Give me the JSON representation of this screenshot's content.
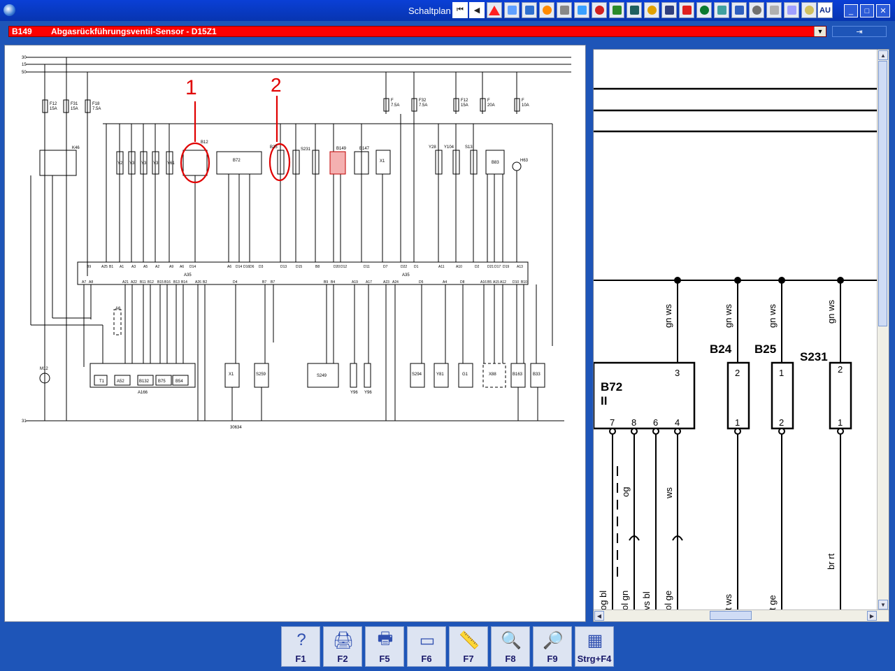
{
  "window": {
    "title": "Schaltplan"
  },
  "toolbar": {
    "nav_first": "⏮",
    "nav_back": "◀",
    "icons": [
      "warning-icon",
      "component-icon",
      "fuse-icon",
      "connector-icon",
      "gauge-icon",
      "wiring-icon",
      "relay-icon",
      "ground-icon",
      "case-icon",
      "earth-icon",
      "tool-icon",
      "signal-icon",
      "tool2-icon",
      "hand-icon",
      "car-icon",
      "check-icon",
      "alarm-icon",
      "chart-icon",
      "list-icon"
    ],
    "language": "AU",
    "min_label": "_",
    "max_label": "□",
    "close_label": "✕"
  },
  "selection": {
    "code": "B149",
    "title": "Abgasrückführungsventil-Sensor - D15Z1",
    "dropdown_arrow": "▼",
    "split_label": "⇥"
  },
  "diagram": {
    "rails": [
      "30",
      "15",
      "50"
    ],
    "ground_rail": "31",
    "fuses": [
      {
        "name": "F12",
        "rating": "15A"
      },
      {
        "name": "F31",
        "rating": "15A"
      },
      {
        "name": "F18",
        "rating": "7.5A"
      },
      {
        "name": "F",
        "rating": "7.5A"
      },
      {
        "name": "F32",
        "rating": "7.5A"
      },
      {
        "name": "F12",
        "rating": "15A"
      },
      {
        "name": "F",
        "rating": "20A"
      },
      {
        "name": "F",
        "rating": "10A"
      }
    ],
    "components_top": [
      "K46",
      "Y2",
      "Y3",
      "Y3",
      "Y3",
      "Y61",
      "B12",
      "B72",
      "B25",
      "S231",
      "B149",
      "B147",
      "X1",
      "Y28",
      "Y104",
      "S13",
      "B83",
      "H63"
    ],
    "roman": [
      "I",
      "II",
      "III",
      "IV",
      "II",
      "I"
    ],
    "ecu": "A35",
    "ecu_label_2": "A35",
    "ecu_pins_top": [
      "B9",
      "A25",
      "B1",
      "A1",
      "A3",
      "A5",
      "A2",
      "A9",
      "A6",
      "D14",
      "A6",
      "D14",
      "D16",
      "D6",
      "D3",
      "D13",
      "D15",
      "B8",
      "D20",
      "D12",
      "D11",
      "D7",
      "D22",
      "D1",
      "A11",
      "A10",
      "D2",
      "D21",
      "D17",
      "D19",
      "A13"
    ],
    "ecu_pins_bottom": [
      "A7",
      "A8",
      "A21",
      "A22",
      "B11",
      "B12",
      "B15",
      "B16",
      "B13",
      "B14",
      "A26",
      "B2",
      "D4",
      "B7",
      "B7",
      "B9",
      "B4",
      "A19",
      "A17",
      "A23",
      "A24",
      "D5",
      "A4",
      "D8",
      "A16",
      "B5",
      "A15",
      "A12",
      "D10",
      "B10"
    ],
    "components_bottom": [
      "A6",
      "T1",
      "A52",
      "B132",
      "B75",
      "B54",
      "A166",
      "X1",
      "S259",
      "S249",
      "Y96",
      "Y96",
      "S294",
      "Y81",
      "G1",
      "X88",
      "B163",
      "B33",
      "M12"
    ],
    "wire_colors": [
      "gn ws",
      "gn ws",
      "gn ws",
      "gn ws",
      "sw gn",
      "gn",
      "sw",
      "br",
      "sw",
      "rt bl",
      "gn sw",
      "ws bl",
      "rt",
      "gn gn",
      "rt ws",
      "br rt",
      "gn rt",
      "ws ws",
      "sw ws",
      "rt bl",
      "ws gn",
      "og bl",
      "rt",
      "gn bl",
      "gn ws",
      "rt gn",
      "gn gn",
      "gn og"
    ],
    "page_number": "30634",
    "annotation_1": "1",
    "annotation_2": "2"
  },
  "zoom_view": {
    "components": [
      {
        "name": "B72",
        "sub": "II"
      },
      {
        "name": "B24"
      },
      {
        "name": "B25"
      },
      {
        "name": "S231"
      }
    ],
    "b72_pins": [
      "7",
      "8",
      "6",
      "4",
      "3"
    ],
    "b24_pins": [
      "2",
      "1"
    ],
    "b25_pins": [
      "1",
      "2"
    ],
    "s231_pins": [
      "2",
      "1"
    ],
    "wire_labels": [
      "gn ws",
      "gn ws",
      "gn ws",
      "gn ws",
      "og",
      "ws",
      "br rt"
    ],
    "bottom_labels": [
      "og bl",
      "ol gn",
      "vs bl",
      "ol ge",
      "t ws",
      "t ge"
    ]
  },
  "function_keys": [
    {
      "icon": "help-icon",
      "glyph": "?",
      "label": "F1"
    },
    {
      "icon": "print-preview-icon",
      "glyph": "🖨",
      "label": "F2"
    },
    {
      "icon": "printer-icon",
      "glyph": "🖶",
      "label": "F5"
    },
    {
      "icon": "card-icon",
      "glyph": "▭",
      "label": "F6"
    },
    {
      "icon": "ruler-icon",
      "glyph": "📏",
      "label": "F7"
    },
    {
      "icon": "zoom-in-icon",
      "glyph": "🔍",
      "label": "F8"
    },
    {
      "icon": "zoom-out-icon",
      "glyph": "🔎",
      "label": "F9"
    },
    {
      "icon": "grid-icon",
      "glyph": "▦",
      "label": "Strg+F4"
    }
  ]
}
